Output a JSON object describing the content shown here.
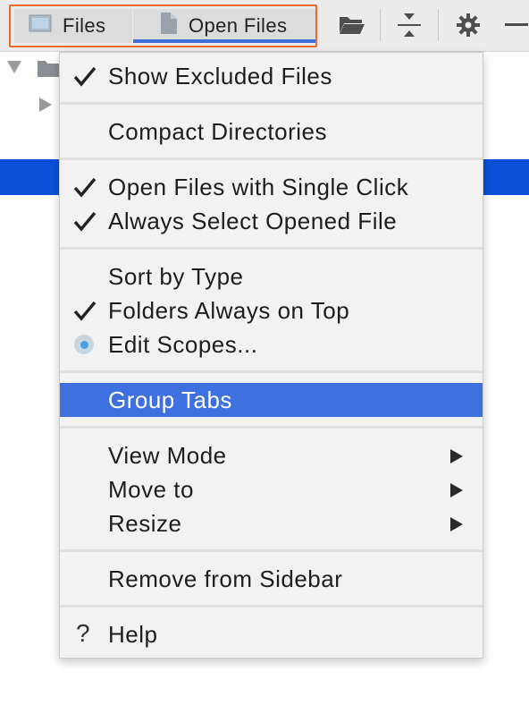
{
  "toolbar": {
    "tabs": [
      {
        "label": "Files",
        "icon": "folder-view-icon",
        "selected": false
      },
      {
        "label": "Open Files",
        "icon": "document-icon",
        "selected": true
      }
    ],
    "actions": [
      {
        "icon": "open-folder-icon"
      },
      {
        "icon": "collapse-all-icon"
      },
      {
        "icon": "gear-icon"
      },
      {
        "icon": "minimize-icon"
      }
    ]
  },
  "menu": {
    "items": [
      {
        "label": "Show Excluded Files",
        "checked": true
      },
      {
        "label": "Compact Directories",
        "checked": false
      },
      {
        "label": "Open Files with Single Click",
        "checked": true
      },
      {
        "label": "Always Select Opened File",
        "checked": true
      },
      {
        "label": "Sort by Type",
        "checked": false
      },
      {
        "label": "Folders Always on Top",
        "checked": true
      },
      {
        "label": "Edit Scopes...",
        "radio": true
      },
      {
        "label": "Group Tabs",
        "highlighted": true
      },
      {
        "label": "View Mode",
        "submenu": true
      },
      {
        "label": "Move to",
        "submenu": true
      },
      {
        "label": "Resize",
        "submenu": true
      },
      {
        "label": "Remove from Sidebar"
      },
      {
        "label": "Help",
        "icon": "question-mark-icon"
      }
    ]
  },
  "colors": {
    "accent_border": "#ee6a2c",
    "selection": "#0b50d7",
    "menu_highlight": "#3e71df",
    "tab_underline": "#3d70d6"
  }
}
